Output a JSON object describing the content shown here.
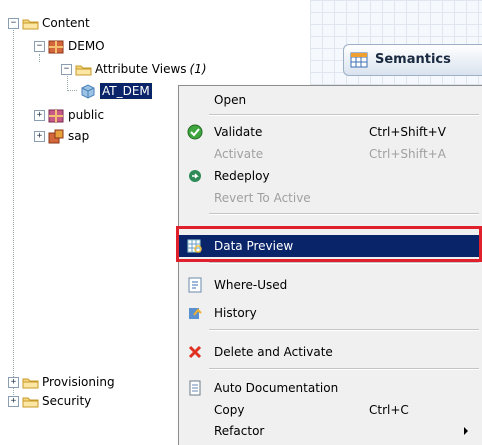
{
  "tree": {
    "content": "Content",
    "demo": "DEMO",
    "attribute_views": "Attribute Views",
    "attribute_views_count": "(1)",
    "at_demo": "AT_DEM",
    "public": "public",
    "sap": "sap",
    "provisioning": "Provisioning",
    "security": "Security",
    "expander_open": "−",
    "expander_closed": "+"
  },
  "editor": {
    "semantics_label": "Semantics"
  },
  "menu": {
    "open": "Open",
    "validate": "Validate",
    "validate_shortcut": "Ctrl+Shift+V",
    "activate": "Activate",
    "activate_shortcut": "Ctrl+Shift+A",
    "redeploy": "Redeploy",
    "revert": "Revert To Active",
    "data_preview": "Data Preview",
    "where_used": "Where-Used",
    "history": "History",
    "delete_activate": "Delete and Activate",
    "auto_doc": "Auto Documentation",
    "copy": "Copy",
    "copy_shortcut": "Ctrl+C",
    "refactor": "Refactor"
  },
  "icons": {
    "folder": "folder-icon",
    "package": "package-icon",
    "attribute_view": "attribute-view-icon",
    "validate": "check-icon",
    "redeploy": "redeploy-icon",
    "data_preview": "data-preview-icon",
    "where_used": "where-used-icon",
    "history": "history-icon",
    "delete": "delete-icon",
    "auto_doc": "document-icon"
  },
  "colors": {
    "selection": "#0a246a",
    "highlight_box": "#e0202a",
    "menu_bg": "#f0f0f0"
  }
}
